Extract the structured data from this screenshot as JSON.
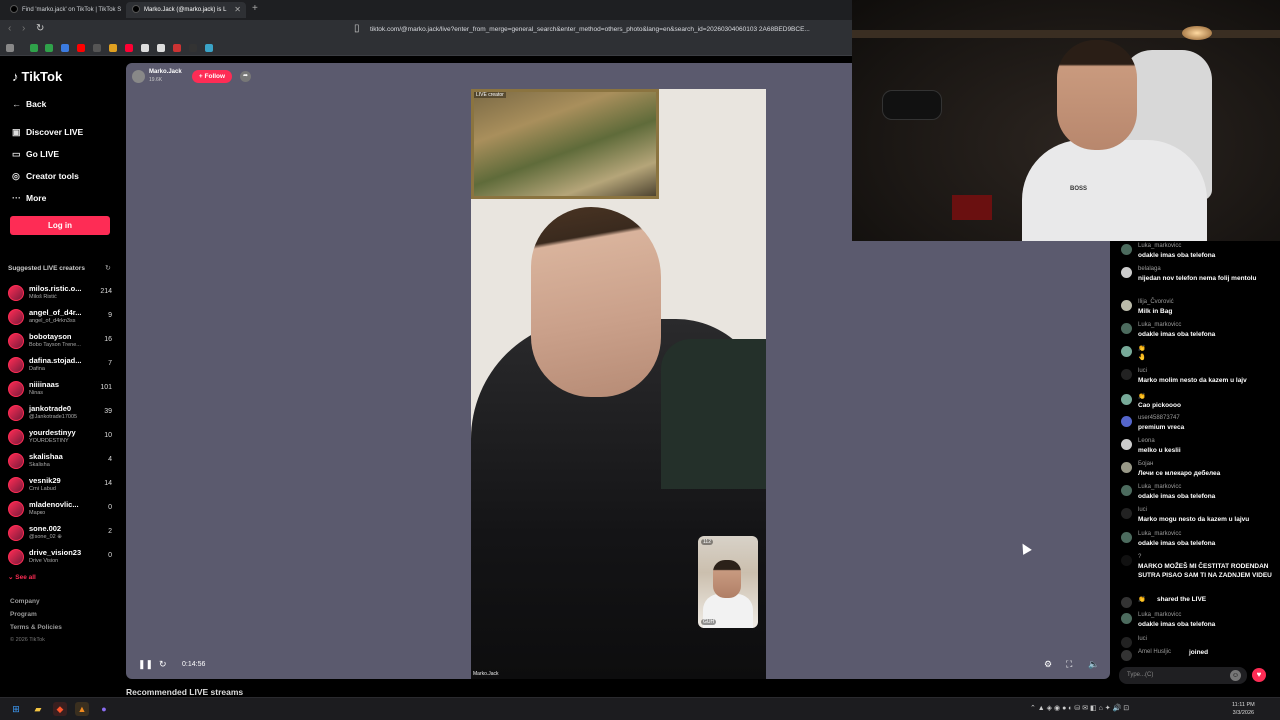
{
  "browser": {
    "tabs": [
      {
        "label": "Find 'marko.jack' on TikTok | TikTok S",
        "active": false
      },
      {
        "label": "Marko.Jack (@marko.jack) is L",
        "active": true
      }
    ],
    "url": "tiktok.com/@marko.jack/live?enter_from_merge=general_search&enter_method=others_photo&lang=en&search_id=20260304060103 2A68BED9BCE..."
  },
  "sidebar": {
    "logo": "TikTok",
    "back": "Back",
    "nav": [
      {
        "label": "Discover LIVE",
        "icon": "live-icon"
      },
      {
        "label": "Go LIVE",
        "icon": "camera-icon"
      },
      {
        "label": "Creator tools",
        "icon": "lightbulb-icon"
      },
      {
        "label": "More",
        "icon": "more-icon"
      }
    ],
    "login": "Log in",
    "suggested_header": "Suggested LIVE creators",
    "creators": [
      {
        "name": "milos.ristic.o...",
        "sub": "Miloš Ristić",
        "count": "214"
      },
      {
        "name": "angel_of_d4r...",
        "sub": "angel_of_d4rkn3ss",
        "count": "9"
      },
      {
        "name": "bobotayson",
        "sub": "Bobo Tayson Trene...",
        "count": "16"
      },
      {
        "name": "dafina.stojad...",
        "sub": "Dafina",
        "count": "7"
      },
      {
        "name": "niiiinaas",
        "sub": "Ninas",
        "count": "101"
      },
      {
        "name": "jankotrade0",
        "sub": "@Jankotrade17005",
        "count": "39"
      },
      {
        "name": "yourdestinyy",
        "sub": "YOURDESTINY",
        "count": "10"
      },
      {
        "name": "skalishaa",
        "sub": "Skalisha",
        "count": "4"
      },
      {
        "name": "vesnik29",
        "sub": "Crni Labud",
        "count": "14"
      },
      {
        "name": "mladenovlic...",
        "sub": "Маркo",
        "count": "0"
      },
      {
        "name": "sone.002",
        "sub": "@sone_02 ⊕",
        "count": "2"
      },
      {
        "name": "drive_vision23",
        "sub": "Drive Vision",
        "count": "0"
      }
    ],
    "see_all": "See all",
    "footer": [
      "Company",
      "Program",
      "Terms & Policies"
    ],
    "copyright": "© 2026 TikTok"
  },
  "stream": {
    "host_name": "Marko.Jack",
    "viewers": "19.6K",
    "follow": "+ Follow",
    "live_tag": "LIVE creator",
    "video_name": "Marko.Jack",
    "pip_badge": "112",
    "pip_label": "GUH",
    "time": "0:14:56",
    "recommended": "Recommended LIVE streams"
  },
  "webcam": {
    "shirt_text": "BOSS"
  },
  "chat": {
    "messages": [
      {
        "user": "Luka_markovicc",
        "text": "odakle imas oba telefona"
      },
      {
        "user": "belalaga",
        "text": "nijedan nov telefon nema folij mentolu"
      },
      {
        "user": "Ilija_Čvorović",
        "text": "Milk in Bag"
      },
      {
        "user": "Luka_markovicc",
        "text": "odakle imas oba telefona"
      },
      {
        "user": "👏",
        "text": "🤚"
      },
      {
        "user": "luci",
        "text": "Marko molim nesto da kazem u lajv"
      },
      {
        "user": "👏",
        "text": "Cao pickoooo"
      },
      {
        "user": "user458873747",
        "text": "premium vreca"
      },
      {
        "user": "Leona",
        "text": "melko u keslii"
      },
      {
        "user": "Бојан",
        "text": "Лечи се млекаро дебелеа"
      },
      {
        "user": "Luka_markovicc",
        "text": "odakle imas oba telefona"
      },
      {
        "user": "luci",
        "text": "Marko mogu nesto da kazem u lajvu"
      },
      {
        "user": "Luka_markovicc",
        "text": "odakle imas oba telefona"
      },
      {
        "user": "?",
        "text": "MARKO MOŽEŠ MI ČESTITAT RODENDAN SUTRA PISAO SAM TI NA ZADNJEM VIDEU"
      },
      {
        "user": "👏",
        "text": "shared the LIVE"
      },
      {
        "user": "Luka_markovicc",
        "text": "odakle imas oba telefona"
      },
      {
        "user": "luci",
        "text": ""
      },
      {
        "user": "Amel Husljic",
        "text": "joined"
      }
    ],
    "input_placeholder": "Type...(C)"
  },
  "taskbar": {
    "time": "11:11 PM",
    "date": "3/3/2026"
  }
}
